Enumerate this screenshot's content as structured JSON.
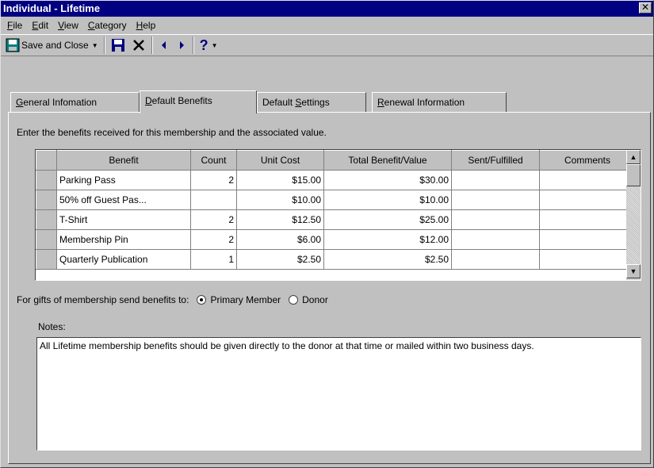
{
  "window": {
    "title": "Individual - Lifetime",
    "close_glyph": "✕"
  },
  "menu": [
    {
      "mnemonic": "F",
      "rest": "ile"
    },
    {
      "mnemonic": "E",
      "rest": "dit"
    },
    {
      "mnemonic": "V",
      "rest": "iew"
    },
    {
      "mnemonic": "C",
      "rest": "ategory"
    },
    {
      "mnemonic": "H",
      "rest": "elp"
    }
  ],
  "toolbar": {
    "save_close_label": "Save and Close",
    "save_icon": "floppy-disk-icon",
    "delete_icon": "x-delete-icon",
    "prev_icon": "left-arrow-icon",
    "next_icon": "right-arrow-icon",
    "help_icon": "question-mark-icon"
  },
  "tabs": [
    {
      "mnemonic": "G",
      "rest": "eneral Infomation"
    },
    {
      "mnemonic": "D",
      "rest": "efault Benefits"
    },
    {
      "pre": "Default ",
      "mnemonic": "S",
      "rest": "ettings"
    },
    {
      "mnemonic": "R",
      "rest": "enewal Information"
    }
  ],
  "active_tab": 1,
  "benefits": {
    "instruction": "Enter the benefits received for this membership and the associated value.",
    "columns": [
      "Benefit",
      "Count",
      "Unit Cost",
      "Total Benefit/Value",
      "Sent/Fulfilled",
      "Comments"
    ],
    "rows": [
      [
        "Parking Pass",
        "2",
        "$15.00",
        "$30.00",
        "",
        ""
      ],
      [
        "50% off Guest Pas...",
        "",
        "$10.00",
        "$10.00",
        "",
        ""
      ],
      [
        "T-Shirt",
        "2",
        "$12.50",
        "$25.00",
        "",
        ""
      ],
      [
        "Membership Pin",
        "2",
        "$6.00",
        "$12.00",
        "",
        ""
      ],
      [
        "Quarterly Publication",
        "1",
        "$2.50",
        "$2.50",
        "",
        ""
      ]
    ]
  },
  "gifts": {
    "label": "For gifts of membership send benefits to:",
    "options": [
      "Primary Member",
      "Donor"
    ],
    "selected": "Primary Member"
  },
  "notes": {
    "label": "Notes:",
    "text": "All Lifetime membership benefits should be given directly to the donor at that time or mailed within two business days."
  }
}
